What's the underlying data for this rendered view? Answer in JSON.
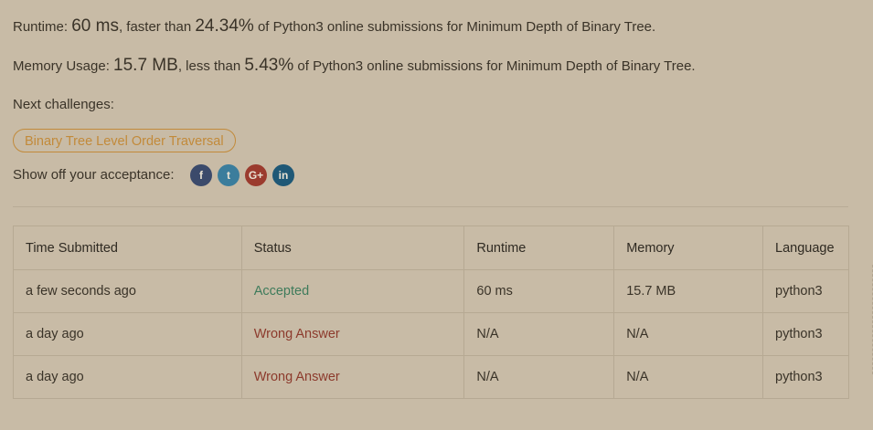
{
  "result": {
    "runtime_label": "Runtime:",
    "runtime_value": "60 ms",
    "runtime_compare": ", faster than",
    "runtime_percent": "24.34%",
    "runtime_tail": "of Python3 online submissions for Minimum Depth of Binary Tree.",
    "memory_label": "Memory Usage:",
    "memory_value": "15.7 MB",
    "memory_compare": ", less than",
    "memory_percent": "5.43%",
    "memory_tail": "of Python3 online submissions for Minimum Depth of Binary Tree."
  },
  "next": {
    "label": "Next challenges:",
    "challenges": [
      "Binary Tree Level Order Traversal"
    ]
  },
  "share": {
    "label": "Show off your acceptance:",
    "icons": [
      {
        "name": "facebook-icon",
        "glyph": "f"
      },
      {
        "name": "twitter-icon",
        "glyph": "t"
      },
      {
        "name": "google-plus-icon",
        "glyph": "G+"
      },
      {
        "name": "linkedin-icon",
        "glyph": "in"
      }
    ]
  },
  "submissions": {
    "columns": [
      "Time Submitted",
      "Status",
      "Runtime",
      "Memory",
      "Language"
    ],
    "rows": [
      {
        "time": "a few seconds ago",
        "status": "Accepted",
        "status_kind": "accepted",
        "runtime": "60 ms",
        "memory": "15.7 MB",
        "language": "python3"
      },
      {
        "time": "a day ago",
        "status": "Wrong Answer",
        "status_kind": "wrong",
        "runtime": "N/A",
        "memory": "N/A",
        "language": "python3"
      },
      {
        "time": "a day ago",
        "status": "Wrong Answer",
        "status_kind": "wrong",
        "runtime": "N/A",
        "memory": "N/A",
        "language": "python3"
      }
    ]
  },
  "colors": {
    "background": "#c8bba6",
    "accepted": "#3e7b5b",
    "wrong": "#8c3a2c",
    "chip": "#c28a3a"
  }
}
